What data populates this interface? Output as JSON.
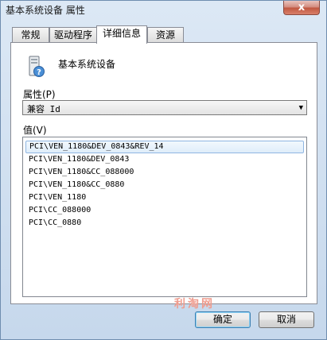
{
  "window": {
    "title": "基本系统设备 属性",
    "close_label": "x"
  },
  "tabs": [
    {
      "label": "常规",
      "active": false
    },
    {
      "label": "驱动程序",
      "active": false
    },
    {
      "label": "详细信息",
      "active": true
    },
    {
      "label": "资源",
      "active": false
    }
  ],
  "device": {
    "name": "基本系统设备",
    "icon": "system-device-question-icon"
  },
  "property": {
    "label": "属性(P)",
    "selected": "兼容 Id",
    "arrow_icon": "dropdown-arrow-icon"
  },
  "value_section": {
    "label": "值(V)",
    "items": [
      "PCI\\VEN_1180&DEV_0843&REV_14",
      "PCI\\VEN_1180&DEV_0843",
      "PCI\\VEN_1180&CC_088000",
      "PCI\\VEN_1180&CC_0880",
      "PCI\\VEN_1180",
      "PCI\\CC_088000",
      "PCI\\CC_0880"
    ],
    "selected_index": 0
  },
  "watermark": "利淘网",
  "buttons": {
    "ok": "确定",
    "cancel": "取消"
  },
  "colors": {
    "selection_border": "#8fb6e2",
    "close_button": "#c0563f"
  }
}
